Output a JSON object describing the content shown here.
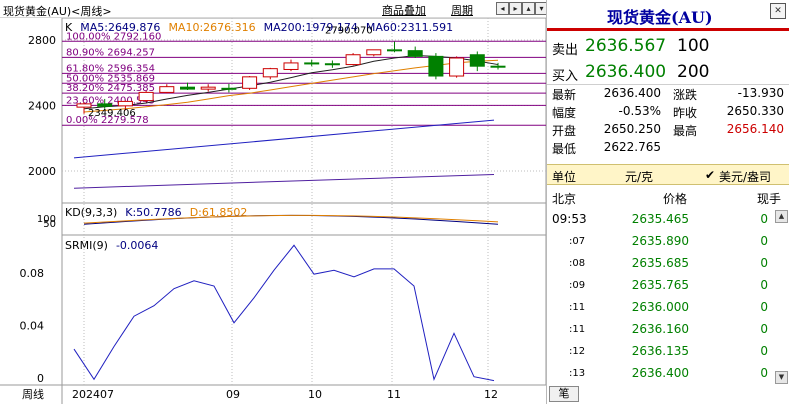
{
  "chart": {
    "title": "现货黄金(AU)<周线>",
    "buttons": {
      "overlay": "商品叠加",
      "period": "周期"
    },
    "arrows": [
      "◂",
      "▸",
      "▴",
      "▾"
    ],
    "ma_legend": [
      {
        "label": "K",
        "color": "#000000"
      },
      {
        "label": "MA5:2649.876",
        "color": "#000080"
      },
      {
        "label": "MA10:2676.316",
        "color": "#e08000"
      },
      {
        "label": "MA200:1979.174",
        "color": "#000080"
      },
      {
        "label": "MA60:2311.591",
        "color": "#000080"
      }
    ],
    "price_axis": [
      "2800",
      "2400",
      "2000"
    ],
    "fib_levels": [
      {
        "label": "100.00% 2792.160",
        "value": 2792.16
      },
      {
        "label": "80.90% 2694.257",
        "value": 2694.257
      },
      {
        "label": "61.80% 2596.354",
        "value": 2596.354
      },
      {
        "label": "50.00% 2535.869",
        "value": 2535.869
      },
      {
        "label": "38.20% 2475.385",
        "value": 2475.385
      },
      {
        "label": "23.60% 2400.545",
        "value": 2400.545
      },
      {
        "label": "0.00% 2279.578",
        "value": 2279.578
      }
    ],
    "high_label": "2790.070",
    "low_label": "2349.406",
    "kd_legend": [
      {
        "label": "KD(9,3,3)",
        "color": "#000000"
      },
      {
        "label": "K:50.7786",
        "color": "#000080"
      },
      {
        "label": "D:61.8502",
        "color": "#e08000"
      }
    ],
    "kd_axis": [
      "100",
      "50"
    ],
    "srmi_legend": [
      {
        "label": "SRMI(9)",
        "color": "#000000"
      },
      {
        "label": "-0.0064",
        "color": "#000080"
      }
    ],
    "srmi_axis": [
      "0.08",
      "0.04",
      "0"
    ],
    "x_axis_title": "周线",
    "x_labels": [
      "202407",
      "09",
      "10",
      "11",
      "12"
    ]
  },
  "chart_data": {
    "type": "candlestick",
    "ylim": [
      1850,
      2850
    ],
    "candles": [
      {
        "o": 2390,
        "h": 2420,
        "l": 2350,
        "c": 2410
      },
      {
        "o": 2410,
        "h": 2440,
        "l": 2380,
        "c": 2395
      },
      {
        "o": 2398,
        "h": 2430,
        "l": 2370,
        "c": 2425
      },
      {
        "o": 2430,
        "h": 2490,
        "l": 2420,
        "c": 2480
      },
      {
        "o": 2480,
        "h": 2530,
        "l": 2475,
        "c": 2515
      },
      {
        "o": 2512,
        "h": 2540,
        "l": 2495,
        "c": 2500
      },
      {
        "o": 2500,
        "h": 2530,
        "l": 2485,
        "c": 2512
      },
      {
        "o": 2505,
        "h": 2532,
        "l": 2480,
        "c": 2500
      },
      {
        "o": 2505,
        "h": 2580,
        "l": 2495,
        "c": 2575
      },
      {
        "o": 2575,
        "h": 2630,
        "l": 2560,
        "c": 2625
      },
      {
        "o": 2620,
        "h": 2680,
        "l": 2610,
        "c": 2660
      },
      {
        "o": 2660,
        "h": 2680,
        "l": 2640,
        "c": 2655
      },
      {
        "o": 2655,
        "h": 2675,
        "l": 2630,
        "c": 2650
      },
      {
        "o": 2650,
        "h": 2720,
        "l": 2645,
        "c": 2710
      },
      {
        "o": 2710,
        "h": 2740,
        "l": 2700,
        "c": 2740
      },
      {
        "o": 2740,
        "h": 2790,
        "l": 2725,
        "c": 2735
      },
      {
        "o": 2735,
        "h": 2760,
        "l": 2690,
        "c": 2700
      },
      {
        "o": 2700,
        "h": 2720,
        "l": 2560,
        "c": 2580
      },
      {
        "o": 2580,
        "h": 2700,
        "l": 2570,
        "c": 2690
      },
      {
        "o": 2710,
        "h": 2730,
        "l": 2610,
        "c": 2640
      },
      {
        "o": 2640,
        "h": 2660,
        "l": 2620,
        "c": 2636
      }
    ],
    "ma5": [
      2380,
      2392,
      2400,
      2415,
      2440,
      2462,
      2480,
      2500,
      2520,
      2542,
      2570,
      2600,
      2618,
      2640,
      2670,
      2690,
      2705,
      2700,
      2690,
      2672,
      2650
    ],
    "ma10": [
      2360,
      2370,
      2380,
      2392,
      2405,
      2420,
      2440,
      2460,
      2475,
      2495,
      2515,
      2535,
      2555,
      2575,
      2595,
      2612,
      2630,
      2645,
      2660,
      2670,
      2676
    ],
    "ma60_start": 2080,
    "ma60_end": 2311,
    "ma200_start": 1895,
    "ma200_end": 1979,
    "kd_k": 50.78,
    "kd_d": 61.85,
    "srmi_ylim": [
      0,
      0.105
    ],
    "srmi": [
      0.022,
      -0.001,
      0.024,
      0.047,
      0.055,
      0.068,
      0.074,
      0.07,
      0.042,
      0.061,
      0.082,
      0.101,
      0.079,
      0.082,
      0.077,
      0.083,
      0.083,
      0.07,
      -0.001,
      0.034,
      0.001,
      -0.002
    ]
  },
  "quote": {
    "title": "现货黄金(AU)",
    "close_icon": "✕",
    "sell": {
      "label": "卖出",
      "price": "2636.567",
      "vol": "100"
    },
    "buy": {
      "label": "买入",
      "price": "2636.400",
      "vol": "200"
    },
    "stats": [
      {
        "k1": "最新",
        "v1": "2636.400",
        "c1": "#000000",
        "k2": "涨跌",
        "v2": "-13.930",
        "c2": "#000000"
      },
      {
        "k1": "幅度",
        "v1": "-0.53%",
        "c1": "#000000",
        "k2": "昨收",
        "v2": "2650.330",
        "c2": "#000000"
      },
      {
        "k1": "开盘",
        "v1": "2650.250",
        "c1": "#000000",
        "k2": "最高",
        "v2": "2656.140",
        "c2": "#cc0000"
      },
      {
        "k1": "最低",
        "v1": "2622.765",
        "c1": "#000000",
        "k2": "",
        "v2": "",
        "c2": "#000000"
      }
    ],
    "unit": {
      "label": "单位",
      "value": "元/克",
      "check": "✔",
      "mode": "美元/盎司"
    },
    "tick_header": {
      "time": "北京",
      "price": "价格",
      "vol": "现手"
    },
    "ticks": [
      {
        "time": "09:53",
        "price": "2635.465",
        "vol": "0"
      },
      {
        "time": ":07",
        "price": "2635.890",
        "vol": "0"
      },
      {
        "time": ":08",
        "price": "2635.685",
        "vol": "0"
      },
      {
        "time": ":09",
        "price": "2635.765",
        "vol": "0"
      },
      {
        "time": ":11",
        "price": "2636.000",
        "vol": "0"
      },
      {
        "time": ":11",
        "price": "2636.160",
        "vol": "0"
      },
      {
        "time": ":12",
        "price": "2636.135",
        "vol": "0"
      },
      {
        "time": ":13",
        "price": "2636.400",
        "vol": "0"
      }
    ],
    "scroll": {
      "up": "▲",
      "down": "▼"
    },
    "bottom_tab": "笔"
  },
  "colors": {
    "up": "#cc0000",
    "down": "#008000",
    "fib": "#800080",
    "ma_dark": "#000080",
    "ma_orange": "#e08000"
  }
}
